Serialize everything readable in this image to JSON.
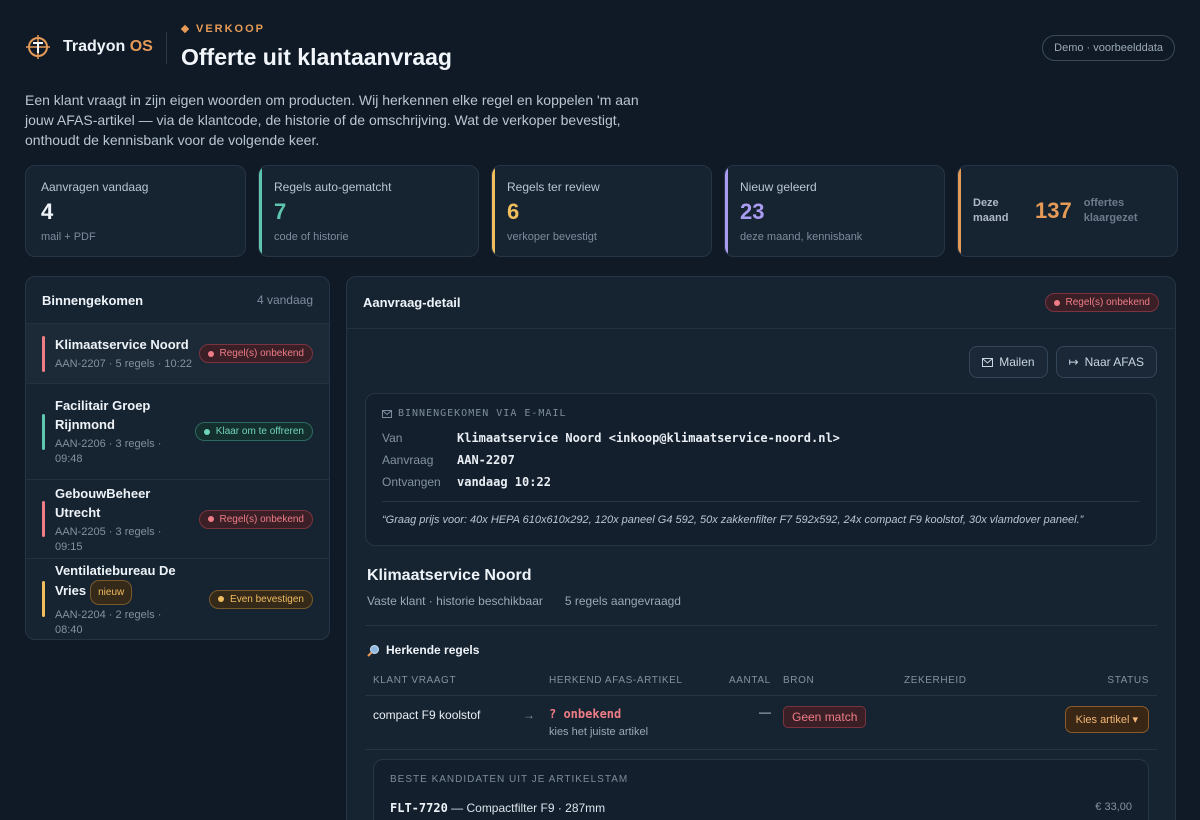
{
  "colors": {
    "accent": "#e59a57",
    "teal": "#5ec6ae",
    "amber": "#f0bd5d",
    "violet": "#a99bef",
    "red": "#f07c86"
  },
  "brand": {
    "name": "Tradyon",
    "suffix": "OS"
  },
  "header": {
    "eyebrow": "VERKOOP",
    "title": "Offerte uit klantaanvraag",
    "demo_badge": "Demo · voorbeelddata"
  },
  "intro": "Een klant vraagt in zijn eigen woorden om producten. Wij herkennen elke regel en koppelen 'm aan jouw AFAS-artikel — via de klantcode, de historie of de omschrijving. Wat de verkoper bevestigt, onthoudt de kennisbank voor de volgende keer.",
  "stats": [
    {
      "label": "Aanvragen vandaag",
      "value": "4",
      "sub": "mail + PDF"
    },
    {
      "label": "Regels auto-gematcht",
      "value": "7",
      "sub": "code of historie"
    },
    {
      "label": "Regels ter review",
      "value": "6",
      "sub": "verkoper bevestigt"
    },
    {
      "label": "Nieuw geleerd",
      "value": "23",
      "sub": "deze maand, kennisbank"
    }
  ],
  "month": {
    "label": "Deze maand",
    "value": "137",
    "sub": "offertes klaargezet"
  },
  "inbox": {
    "title": "Binnengekomen",
    "count": "4 vandaag",
    "items": [
      {
        "name": "Klimaatservice Noord",
        "meta": "AAN-2207 · 5 regels · 10:22",
        "status": "Regel(s) onbekend"
      },
      {
        "name": "Facilitair Groep Rijnmond",
        "meta": "AAN-2206 · 3 regels · 09:48",
        "status": "Klaar om te offreren"
      },
      {
        "name": "GebouwBeheer Utrecht",
        "meta": "AAN-2205 · 3 regels · 09:15",
        "status": "Regel(s) onbekend"
      },
      {
        "name": "Ventilatiebureau De Vries",
        "badge": "nieuw",
        "meta": "AAN-2204 · 2 regels · 08:40",
        "status": "Even bevestigen"
      }
    ]
  },
  "detail": {
    "title": "Aanvraag-detail",
    "status": "Regel(s) onbekend",
    "actions": {
      "mail": "Mailen",
      "afas": "Naar AFAS"
    },
    "mail": {
      "label": "BINNENGEKOMEN VIA E-MAIL",
      "from_key": "Van",
      "from": "Klimaatservice Noord <inkoop@klimaatservice-noord.nl>",
      "request_key": "Aanvraag",
      "request": "AAN-2207",
      "received_key": "Ontvangen",
      "received": "vandaag 10:22",
      "quote": "“Graag prijs voor: 40x HEPA 610x610x292, 120x paneel G4 592, 50x zakkenfilter F7 592x592, 24x compact F9 koolstof, 30x vlamdover paneel.”"
    },
    "client": {
      "name": "Klimaatservice Noord",
      "meta1": "Vaste klant · historie beschikbaar",
      "meta2": "5 regels aangevraagd"
    },
    "rules": {
      "title": "Herkende regels",
      "headers": [
        "KLANT VRAAGT",
        "HERKEND AFAS-ARTIKEL",
        "AANTAL",
        "BRON",
        "ZEKERHEID",
        "STATUS"
      ],
      "row": {
        "ask": "compact F9 koolstof",
        "arrow": "→",
        "match": "? onbekend",
        "hint": "kies het juiste artikel",
        "qty": "—",
        "source": "Geen match",
        "action": "Kies artikel"
      },
      "candidates": {
        "label": "BESTE KANDIDATEN UIT JE ARTIKELSTAM",
        "code": "FLT-7720",
        "desc": "— Compactfilter F9 · 287mm",
        "price": "€ 33,00"
      }
    }
  }
}
